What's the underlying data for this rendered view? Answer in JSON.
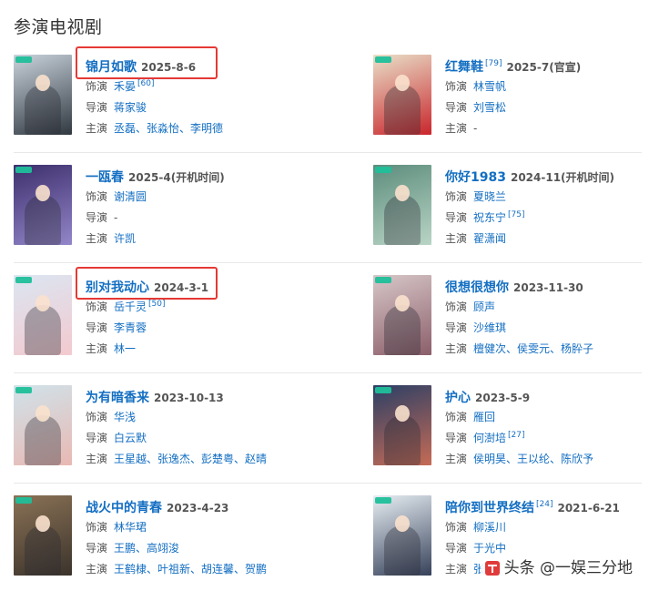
{
  "section": {
    "title": "参演电视剧"
  },
  "labels": {
    "role": "饰演",
    "director": "导演",
    "star": "主演"
  },
  "dramas": [
    {
      "title": "锦月如歌",
      "date": "2025-8-6",
      "date_note": "",
      "role": "禾晏",
      "role_ref": "[60]",
      "director": "蒋家骏",
      "director_ref": "",
      "stars": "丞磊、张淼怡、李明德",
      "colors": [
        "#c9d3dc",
        "#303840"
      ],
      "highlight": true
    },
    {
      "title": "红舞鞋",
      "date": "2025-7(官宣)",
      "date_note": "",
      "title_ref": "[79]",
      "role": "林雪帆",
      "role_ref": "",
      "director": "刘雪松",
      "director_ref": "",
      "stars": "-",
      "colors": [
        "#e9e0c9",
        "#c9262c"
      ],
      "highlight": false
    },
    {
      "title": "一瓯春",
      "date": "2025-4(开机时间)",
      "date_note": "",
      "role": "谢清圆",
      "role_ref": "",
      "director": "-",
      "director_ref": "",
      "stars": "许凯",
      "colors": [
        "#3d2f6d",
        "#9386c9"
      ],
      "highlight": false
    },
    {
      "title": "你好1983",
      "date": "2024-11(开机时间)",
      "date_note": "",
      "role": "夏晓兰",
      "role_ref": "",
      "director": "祝东宁",
      "director_ref": "[75]",
      "stars": "翟潇闻",
      "colors": [
        "#5d8d7d",
        "#b9d5c6"
      ],
      "highlight": false
    },
    {
      "title": "别对我动心",
      "date": "2024-3-1",
      "date_note": "",
      "role": "岳千灵",
      "role_ref": "[50]",
      "director": "李青蓉",
      "director_ref": "",
      "stars": "林一",
      "colors": [
        "#dbe6f2",
        "#f3c9cf"
      ],
      "highlight": true
    },
    {
      "title": "很想很想你",
      "date": "2023-11-30",
      "date_note": "",
      "role": "顾声",
      "role_ref": "",
      "director": "沙维琪",
      "director_ref": "",
      "stars": "檀健次、侯雯元、杨肸子",
      "colors": [
        "#d7c7c9",
        "#8b5e6a"
      ],
      "highlight": false
    },
    {
      "title": "为有暗香来",
      "date": "2023-10-13",
      "date_note": "",
      "role": "华浅",
      "role_ref": "",
      "director": "白云默",
      "director_ref": "",
      "stars": "王星越、张逸杰、彭楚粤、赵晴",
      "colors": [
        "#cfe3ea",
        "#e9b8b3"
      ],
      "highlight": false
    },
    {
      "title": "护心",
      "date": "2023-5-9",
      "date_note": "",
      "role": "雁回",
      "role_ref": "",
      "director": "何澍培",
      "director_ref": "[27]",
      "stars": "侯明昊、王以纶、陈欣予",
      "colors": [
        "#2b3f66",
        "#c66b55"
      ],
      "highlight": false
    },
    {
      "title": "战火中的青春",
      "date": "2023-4-23",
      "date_note": "",
      "role": "林华珺",
      "role_ref": "",
      "director": "王鹏、高翊浚",
      "director_ref": "",
      "stars": "王鹤棣、叶祖新、胡连馨、贺鹏",
      "colors": [
        "#8a7256",
        "#3b332b"
      ],
      "highlight": false
    },
    {
      "title": "陪你到世界终结",
      "date": "2021-6-21",
      "date_note": "",
      "title_ref": "[24]",
      "role": "柳溪川",
      "role_ref": "",
      "director": "于光中",
      "director_ref": "",
      "stars": "张耀",
      "colors": [
        "#e7eef3",
        "#36415a"
      ],
      "highlight": false
    }
  ],
  "watermark": {
    "text": "头条 @一娱三分地"
  }
}
